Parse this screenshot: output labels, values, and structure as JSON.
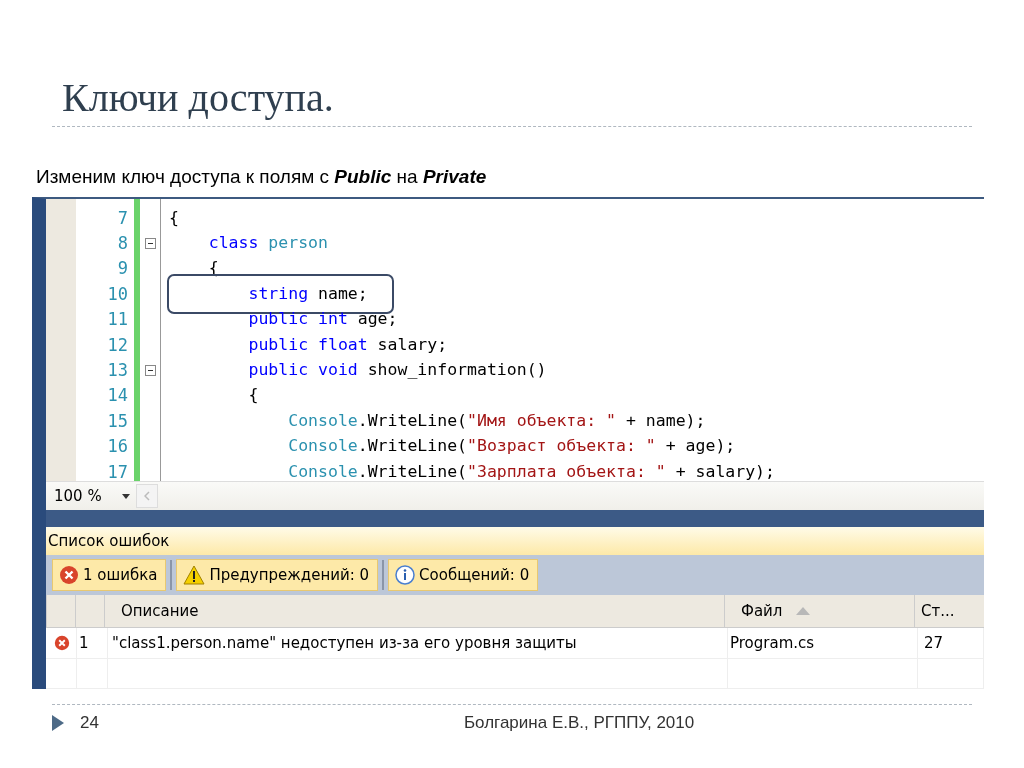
{
  "slide": {
    "title": "Ключи доступа.",
    "subtitle": "Изменим ключ доступа к полям с **Public** на **Private**"
  },
  "editor": {
    "lines": [
      {
        "number": "7",
        "kind": "line",
        "outlined": false,
        "tokens": [
          {
            "kind": "plain",
            "text": "{"
          }
        ]
      },
      {
        "number": "8",
        "kind": "block_start",
        "outlined": false,
        "tokens": [
          {
            "kind": "keyword",
            "text": "    class"
          },
          {
            "kind": "type",
            "text": " person"
          }
        ]
      },
      {
        "number": "9",
        "kind": "line",
        "outlined": false,
        "tokens": [
          {
            "kind": "plain",
            "text": "    {"
          }
        ]
      },
      {
        "number": "10",
        "kind": "line",
        "outlined": true,
        "tokens": [
          {
            "kind": "keyword",
            "text": "        string"
          },
          {
            "kind": "plain",
            "text": " name;"
          }
        ]
      },
      {
        "number": "11",
        "kind": "line",
        "outlined": false,
        "tokens": [
          {
            "kind": "keyword",
            "text": "        public int"
          },
          {
            "kind": "plain",
            "text": " age;"
          }
        ]
      },
      {
        "number": "12",
        "kind": "line",
        "outlined": false,
        "tokens": [
          {
            "kind": "keyword",
            "text": "        public float"
          },
          {
            "kind": "plain",
            "text": " salary;"
          }
        ]
      },
      {
        "number": "13",
        "kind": "block_start",
        "outlined": false,
        "tokens": [
          {
            "kind": "keyword",
            "text": "        public void"
          },
          {
            "kind": "plain",
            "text": " show_information()"
          }
        ]
      },
      {
        "number": "14",
        "kind": "line",
        "outlined": false,
        "tokens": [
          {
            "kind": "plain",
            "text": "        {"
          }
        ]
      },
      {
        "number": "15",
        "kind": "line",
        "outlined": false,
        "tokens": [
          {
            "kind": "type",
            "text": "            Console"
          },
          {
            "kind": "plain",
            "text": ".WriteLine("
          },
          {
            "kind": "string",
            "text": "\"Имя объекта: \""
          },
          {
            "kind": "plain",
            "text": " + name);"
          }
        ]
      },
      {
        "number": "16",
        "kind": "line",
        "outlined": false,
        "tokens": [
          {
            "kind": "type",
            "text": "            Console"
          },
          {
            "kind": "plain",
            "text": ".WriteLine("
          },
          {
            "kind": "string",
            "text": "\"Возраст объекта: \""
          },
          {
            "kind": "plain",
            "text": " + age);"
          }
        ]
      },
      {
        "number": "17",
        "kind": "line",
        "outlined": false,
        "tokens": [
          {
            "kind": "type",
            "text": "            Console"
          },
          {
            "kind": "plain",
            "text": ".WriteLine("
          },
          {
            "kind": "string",
            "text": "\"Зарплата объекта: \""
          },
          {
            "kind": "plain",
            "text": " + salary);"
          }
        ]
      }
    ],
    "zoom": "100 %"
  },
  "error_list": {
    "title": "Список ошибок",
    "filters": [
      {
        "kind": "error",
        "label": "1 ошибка",
        "selected": true
      },
      {
        "kind": "warning",
        "label": "Предупреждений: 0",
        "selected": true
      },
      {
        "kind": "info",
        "label": "Сообщений: 0",
        "selected": true
      }
    ],
    "columns": [
      {
        "label": "Описание",
        "sorted": false
      },
      {
        "label": "Файл",
        "sorted": true
      },
      {
        "label": "Ст...",
        "sorted": false
      }
    ],
    "rows": [
      {
        "kind": "error",
        "number": "1",
        "description": "\"class1.person.name\" недоступен из-за его уровня защиты",
        "file": "Program.cs",
        "line": "27"
      }
    ]
  },
  "footer": {
    "page": "24",
    "author": "Болгарина Е.В., РГППУ, 2010"
  }
}
